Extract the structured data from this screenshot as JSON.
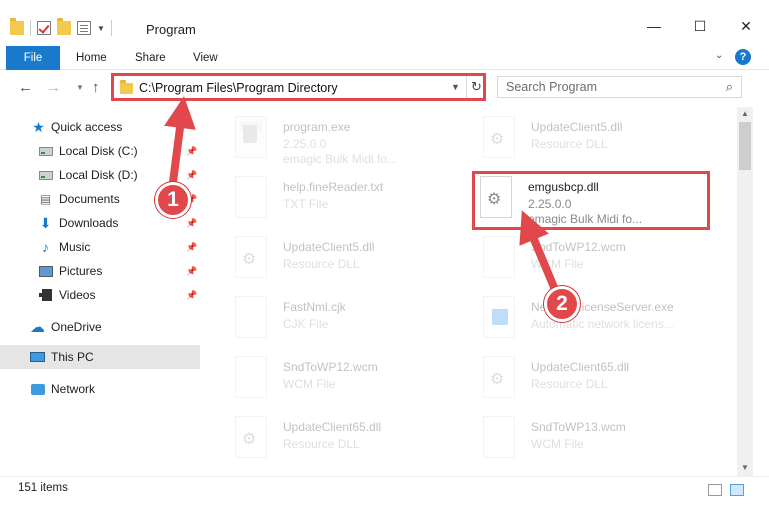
{
  "window": {
    "title": "Program"
  },
  "ribbon": {
    "file": "File",
    "tabs": [
      "Home",
      "Share",
      "View"
    ],
    "help": "?"
  },
  "address": {
    "path": "C:\\Program Files\\Program Directory"
  },
  "search": {
    "placeholder": "Search Program"
  },
  "sidebar": {
    "quick_access": "Quick access",
    "items": [
      {
        "label": "Local Disk (C:)",
        "icon": "hard-drive-icon",
        "pinned": true
      },
      {
        "label": "Local Disk (D:)",
        "icon": "hard-drive-icon",
        "pinned": true
      },
      {
        "label": "Documents",
        "icon": "document-icon",
        "pinned": true
      },
      {
        "label": "Downloads",
        "icon": "download-icon",
        "pinned": true
      },
      {
        "label": "Music",
        "icon": "music-icon",
        "pinned": true
      },
      {
        "label": "Pictures",
        "icon": "pictures-icon",
        "pinned": true
      },
      {
        "label": "Videos",
        "icon": "video-icon",
        "pinned": true
      }
    ],
    "onedrive": "OneDrive",
    "this_pc": "This PC",
    "network": "Network"
  },
  "files": [
    {
      "name": "program.exe",
      "meta1": "2.25.0.0",
      "meta2": "emagic Bulk Midi fo...",
      "icon": "exe-icon"
    },
    {
      "name": "UpdateClient5.dll",
      "meta1": "Resource DLL",
      "meta2": "",
      "icon": "dll-gear-icon"
    },
    {
      "name": "help.fineReader.txt",
      "meta1": "TXT File",
      "meta2": "",
      "icon": "blank-file-icon"
    },
    {
      "name": "emgusbcp.dll",
      "meta1": "2.25.0.0",
      "meta2": "emagic Bulk Midi fo...",
      "icon": "dll-gear-icon"
    },
    {
      "name": "UpdateClient5.dll",
      "meta1": "Resource DLL",
      "meta2": "",
      "icon": "dll-gear-icon"
    },
    {
      "name": "SndToWP12.wcm",
      "meta1": "WCM File",
      "meta2": "",
      "icon": "blank-file-icon"
    },
    {
      "name": "FastNml.cjk",
      "meta1": "CJK File",
      "meta2": "",
      "icon": "blank-file-icon"
    },
    {
      "name": "NetworkLicenseServer.exe",
      "meta1": "Automatic network licens...",
      "meta2": "",
      "icon": "app-icon"
    },
    {
      "name": "SndToWP12.wcm",
      "meta1": "WCM File",
      "meta2": "",
      "icon": "blank-file-icon"
    },
    {
      "name": "UpdateClient65.dll",
      "meta1": "Resource DLL",
      "meta2": "",
      "icon": "dll-gear-icon"
    },
    {
      "name": "UpdateClient65.dll",
      "meta1": "Resource DLL",
      "meta2": "",
      "icon": "dll-gear-icon"
    },
    {
      "name": "SndToWP13.wcm",
      "meta1": "WCM File",
      "meta2": "",
      "icon": "blank-file-icon"
    }
  ],
  "status": {
    "item_count": "151 items"
  },
  "callouts": {
    "step1": "1",
    "step2": "2"
  },
  "colors": {
    "highlight": "#e0484b",
    "accent": "#1979ca"
  }
}
